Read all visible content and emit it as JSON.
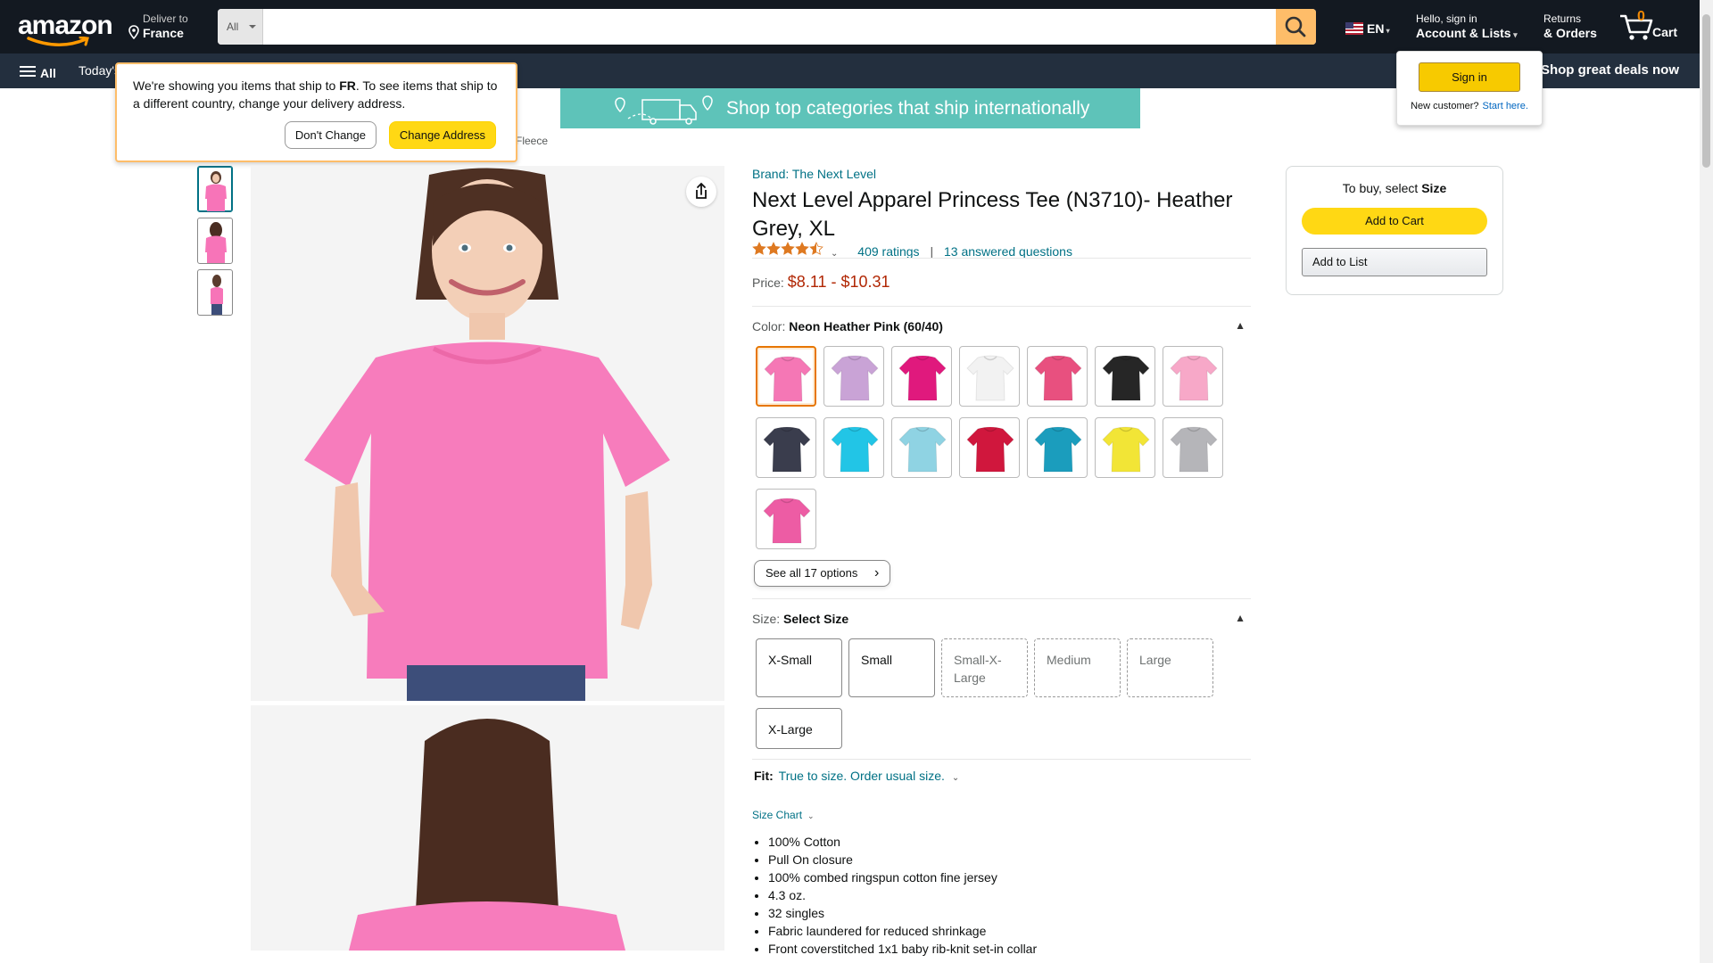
{
  "nav": {
    "logo": "amazon",
    "deliver_line1": "Deliver to",
    "deliver_line2": "France",
    "search_dept": "All",
    "search_placeholder": "",
    "lang": "EN",
    "account_line1": "Hello, sign in",
    "account_line2": "Account & Lists",
    "returns_line1": "Returns",
    "returns_line2": "& Orders",
    "cart_count": "0",
    "cart_label": "Cart",
    "all_label": "All",
    "today": "Today's",
    "deals": "Shop great deals now"
  },
  "popover": {
    "text_pre": "We're showing you items that ship to ",
    "country": "FR",
    "text_post": ". To see items that ship to a different country, change your delivery address.",
    "dont_change": "Don't Change",
    "change_address": "Change Address"
  },
  "signin_flyout": {
    "button": "Sign in",
    "new_customer": "New customer?",
    "start_here": "Start here."
  },
  "banner": {
    "text": "Shop top categories that ship internationally"
  },
  "breadcrumb": {
    "tail": "Fleece"
  },
  "product": {
    "brand": "Brand: The Next Level",
    "title": "Next Level Apparel Princess Tee (N3710)- Heather Grey, XL",
    "rating_value": 4.5,
    "ratings_count": "409 ratings",
    "answered": "13 answered questions",
    "price_label": "Price:",
    "price": "$8.11 - $10.31",
    "color_label": "Color:",
    "color_value": "Neon Heather Pink (60/40)",
    "see_all": "See all 17 options",
    "size_label": "Size:",
    "size_value": "Select Size",
    "fit_label": "Fit:",
    "fit_value": "True to size. Order usual size.",
    "size_chart": "Size Chart",
    "sizes": [
      {
        "label": "X-Small",
        "available": true
      },
      {
        "label": "Small",
        "available": true
      },
      {
        "label": "Small-X-Large",
        "available": false
      },
      {
        "label": "Medium",
        "available": false
      },
      {
        "label": "Large",
        "available": false
      },
      {
        "label": "X-Large",
        "available": true
      }
    ],
    "swatch_colors": [
      "#f577b5",
      "#c9a3d6",
      "#e0197d",
      "#f2f2f2",
      "#e8507f",
      "#262626",
      "#f7a8c8",
      "#3a3d4d",
      "#22c5e6",
      "#8fd3e3",
      "#d0173d",
      "#1b9dbd",
      "#f2e536",
      "#b5b5b9",
      "#ed5ca4"
    ],
    "bullets": [
      "100% Cotton",
      "Pull On closure",
      "100% combed ringspun cotton fine jersey",
      "4.3 oz.",
      "32 singles",
      "Fabric laundered for reduced shrinkage",
      "Front coverstitched 1x1 baby rib-knit set-in collar"
    ]
  },
  "buybox": {
    "to_buy_pre": "To buy, select ",
    "to_buy_bold": "Size",
    "add_to_cart": "Add to Cart",
    "add_to_list": "Add to List"
  },
  "colors": {
    "nav_dark": "#131921",
    "nav_sub": "#232f3e",
    "accent": "#febd69",
    "price": "#b12704",
    "link": "#007185"
  }
}
